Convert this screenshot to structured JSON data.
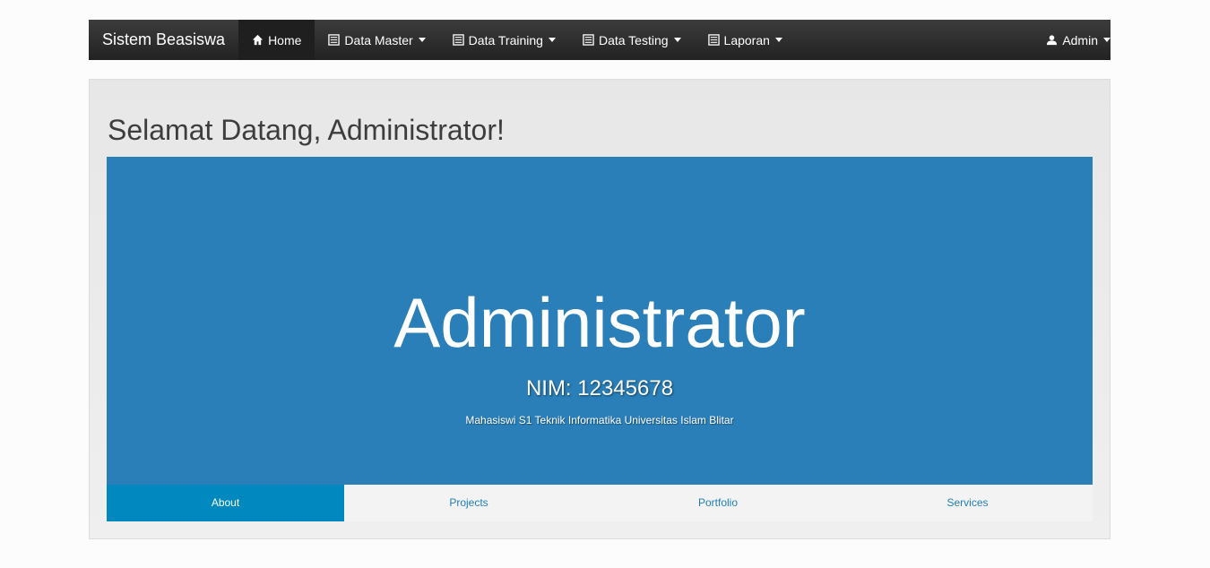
{
  "navbar": {
    "brand": "Sistem Beasiswa",
    "items": [
      {
        "label": "Home",
        "icon": "home-icon"
      },
      {
        "label": "Data Master",
        "icon": "list-icon"
      },
      {
        "label": "Data Training",
        "icon": "list-icon"
      },
      {
        "label": "Data Testing",
        "icon": "list-icon"
      },
      {
        "label": "Laporan",
        "icon": "list-icon"
      }
    ],
    "user": {
      "label": "Admin",
      "icon": "user-icon"
    }
  },
  "main": {
    "welcome": "Selamat Datang, Administrator!",
    "hero": {
      "name": "Administrator",
      "nim": "NIM: 12345678",
      "description": "Mahasiswi S1 Teknik Informatika Universitas Islam Blitar",
      "background": "#2a7fb8"
    },
    "tabs": [
      {
        "label": "About"
      },
      {
        "label": "Projects"
      },
      {
        "label": "Portfolio"
      },
      {
        "label": "Services"
      }
    ]
  }
}
